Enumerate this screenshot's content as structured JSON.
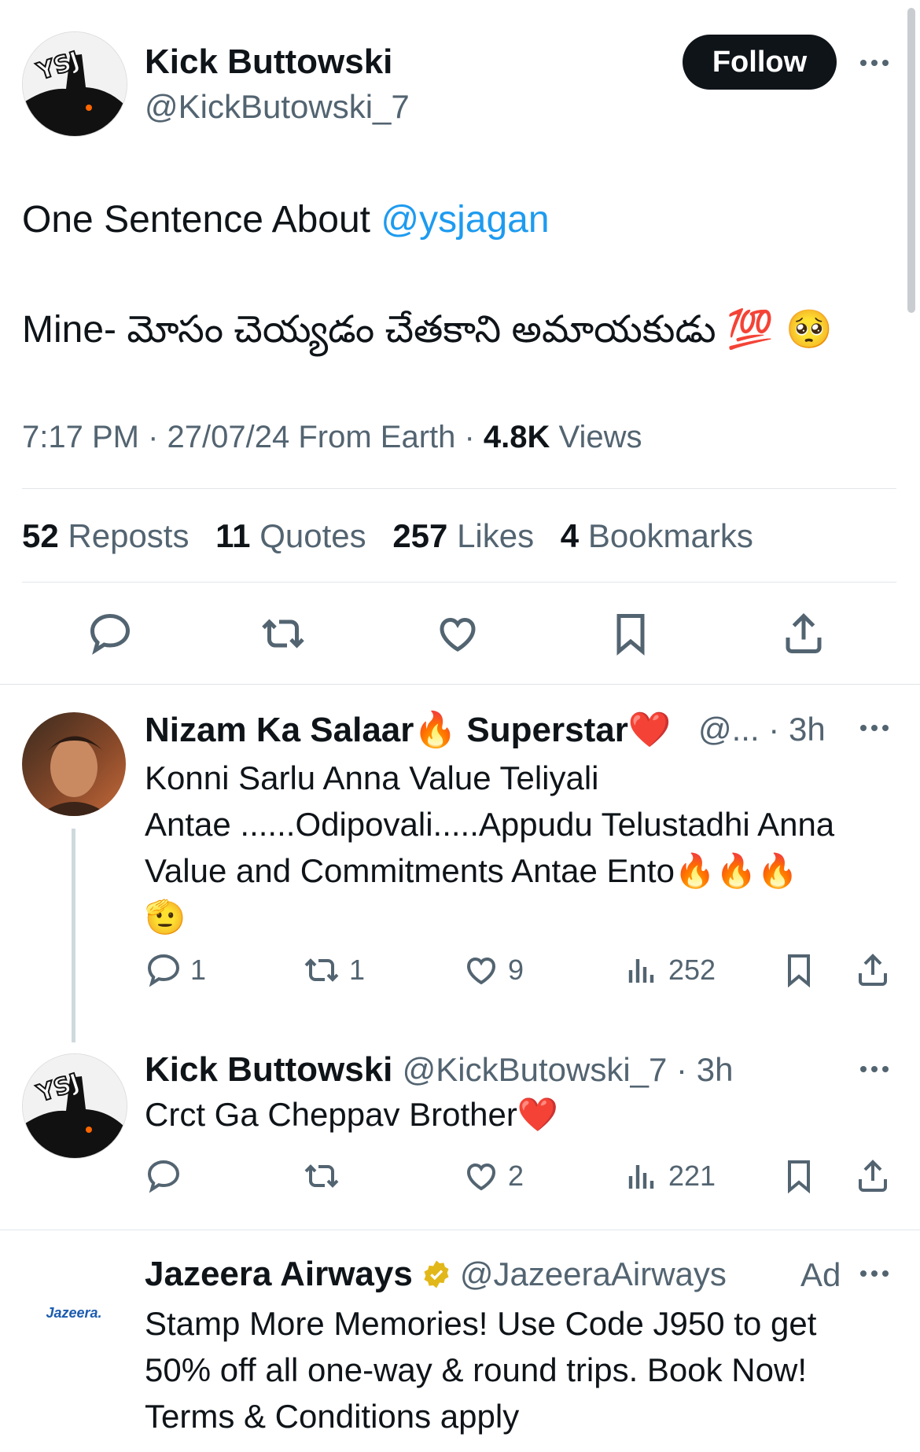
{
  "main_tweet": {
    "author_name": "Kick Buttowski",
    "author_handle": "@KickButowski_7",
    "follow_label": "Follow",
    "line1_text": "One Sentence About ",
    "line1_mention": "@ysjagan",
    "line2_text": "Mine- మోసం చెయ్యడం చేతకాని అమాయకుడు",
    "line2_emojis": "💯 🥺",
    "time": "7:17 PM",
    "date_source": "27/07/24 From Earth",
    "views_count": "4.8K",
    "views_label": "Views",
    "stats": {
      "reposts_count": "52",
      "reposts_label": "Reposts",
      "quotes_count": "11",
      "quotes_label": "Quotes",
      "likes_count": "257",
      "likes_label": "Likes",
      "bookmarks_count": "4",
      "bookmarks_label": "Bookmarks"
    }
  },
  "reply1": {
    "author_name": "Nizam Ka Salaar🔥 Superstar❤️",
    "handle_time": "@... · 3h",
    "text_line1": "Konni Sarlu Anna Value Teliyali",
    "text_line2": "Antae ......Odipovali.....Appudu Telustadhi Anna",
    "text_line3": "Value and Commitments Antae Ento🔥🔥🔥",
    "text_line4": "🫡",
    "replies": "1",
    "reposts": "1",
    "likes": "9",
    "views": "252"
  },
  "reply2": {
    "author_name": "Kick Buttowski",
    "handle_time": "@KickButowski_7 · 3h",
    "text": "Crct Ga Cheppav Brother❤️",
    "likes": "2",
    "views": "221"
  },
  "ad": {
    "author_name": "Jazeera Airways",
    "handle": "@JazeeraAirways",
    "ad_label": "Ad",
    "logo_text": "Jazeera.",
    "text_line1": "Stamp More Memories! Use Code J950 to get",
    "text_line2": "50% off all one-way & round trips. Book Now!",
    "text_line3": "Terms & Conditions apply"
  },
  "colors": {
    "accent": "#1d9bf0",
    "text": "#0f1419",
    "muted": "#536471",
    "divider": "#e1e6ea",
    "verified_gold": "#e2b719"
  },
  "icons": [
    "reply-icon",
    "repost-icon",
    "like-icon",
    "bookmark-icon",
    "share-icon",
    "views-icon",
    "more-icon",
    "verified-icon"
  ]
}
